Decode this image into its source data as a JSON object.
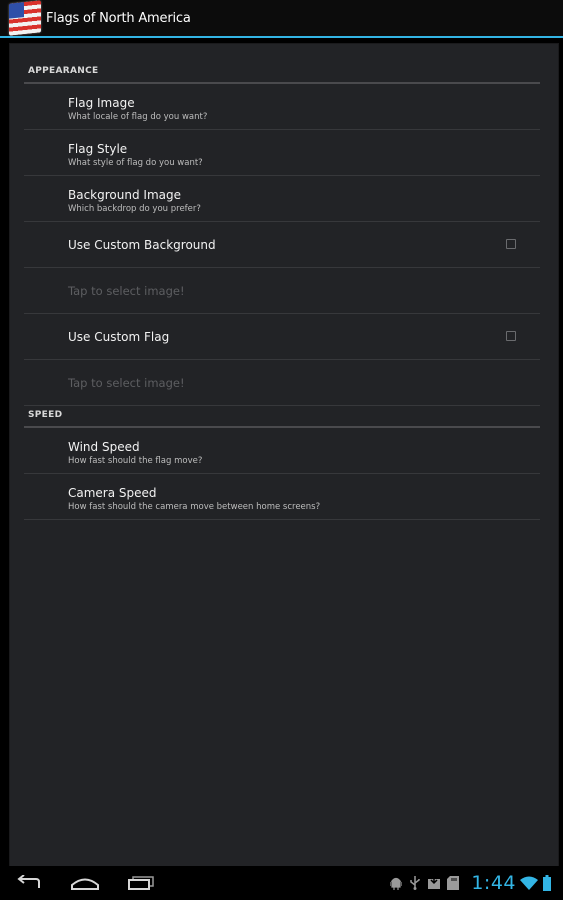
{
  "app": {
    "title": "Flags of North America"
  },
  "sections": [
    {
      "header": "APPEARANCE",
      "prefs": [
        {
          "title": "Flag Image",
          "summary": "What locale of flag do you want?"
        },
        {
          "title": "Flag Style",
          "summary": "What style of flag do you want?"
        },
        {
          "title": "Background Image",
          "summary": "Which backdrop do you prefer?"
        },
        {
          "title": "Use Custom Background",
          "checkbox": false
        },
        {
          "title": "Tap to select image!",
          "disabled": true
        },
        {
          "title": "Use Custom Flag",
          "checkbox": false
        },
        {
          "title": "Tap to select image!",
          "disabled": true
        }
      ]
    },
    {
      "header": "SPEED",
      "prefs": [
        {
          "title": "Wind Speed",
          "summary": "How fast should the flag move?"
        },
        {
          "title": "Camera Speed",
          "summary": "How fast should the camera move between home screens?"
        }
      ]
    }
  ],
  "statusbar": {
    "time": "1:44"
  },
  "colors": {
    "accent": "#33b5e5",
    "panel": "#222326"
  },
  "icons": {
    "nav": [
      "back-icon",
      "home-icon",
      "recent-apps-icon"
    ],
    "status": [
      "android-debug-icon",
      "usb-icon",
      "download-icon",
      "sd-card-icon",
      "wifi-icon",
      "battery-icon"
    ]
  }
}
